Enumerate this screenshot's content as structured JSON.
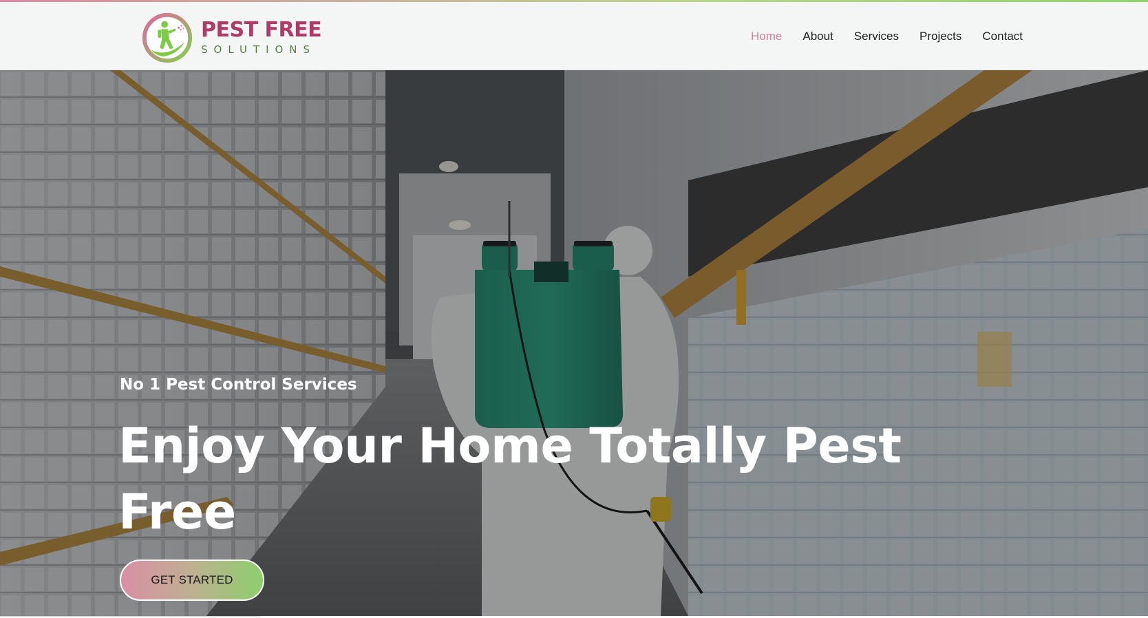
{
  "brand": {
    "name": "PEST FREE",
    "tagline": "SOLUTIONS",
    "colors": {
      "primary_pink": "#b03a66",
      "accent_pink": "#d67f9d",
      "accent_green": "#8ccf6c",
      "dark_green": "#5d7d46"
    }
  },
  "nav": {
    "items": [
      {
        "label": "Home",
        "active": true
      },
      {
        "label": "About",
        "active": false
      },
      {
        "label": "Services",
        "active": false
      },
      {
        "label": "Projects",
        "active": false
      },
      {
        "label": "Contact",
        "active": false
      }
    ]
  },
  "hero": {
    "eyebrow": "No 1 Pest Control Services",
    "title": "Enjoy Your Home Totally Pest Free",
    "cta_label": "GET STARTED",
    "background_icon": "warehouse-pest-control-worker-photo"
  }
}
